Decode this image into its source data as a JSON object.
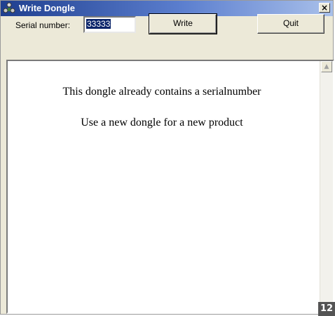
{
  "window": {
    "title": "Write Dongle",
    "app_icon": "dongle-app-icon",
    "close_glyph": "×",
    "colors": {
      "titlebar_start": "#1f3f8f",
      "titlebar_end": "#a9c0ea",
      "face": "#ece9d8",
      "selection": "#0a246a"
    }
  },
  "toolbar": {
    "serial_label": "Serial number:",
    "serial_value": "33333",
    "write_label": "Write",
    "quit_label": "Quit"
  },
  "content": {
    "messages": [
      "This dongle already contains a serialnumber",
      "Use a new dongle for a new product"
    ],
    "scroll_up_glyph": "▲"
  },
  "badge": {
    "text": "12"
  }
}
